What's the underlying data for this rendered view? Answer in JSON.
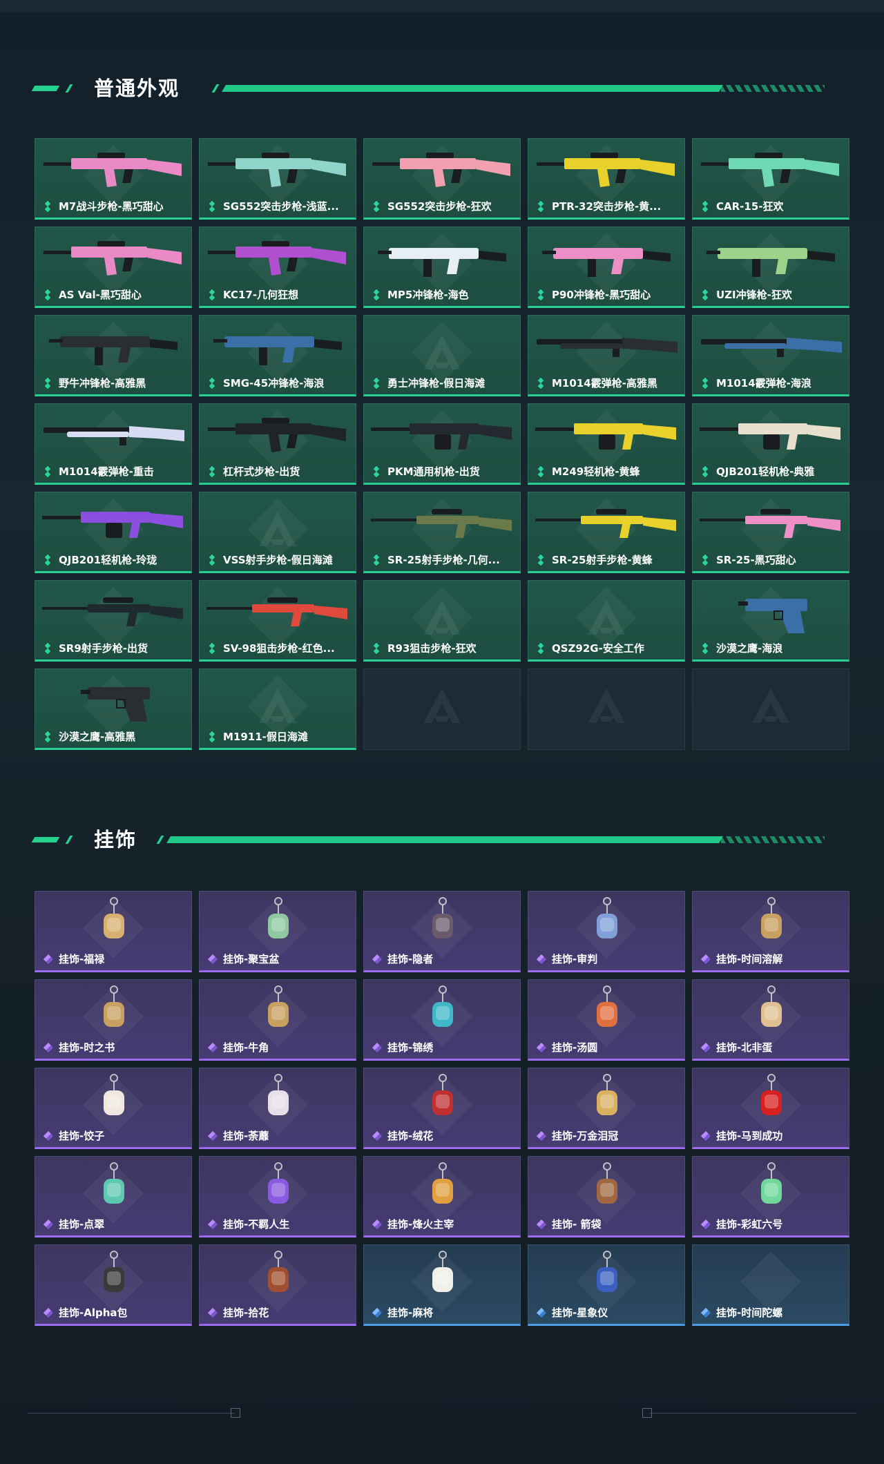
{
  "sections": {
    "skins_title": "普通外观",
    "charms_title": "挂饰"
  },
  "skins": [
    {
      "label": "M7战斗步枪-黑巧甜心",
      "color": "#e98ac6",
      "icon": "rifle-icon"
    },
    {
      "label": "SG552突击步枪-浅蓝...",
      "color": "#8fd4c9",
      "icon": "rifle-icon"
    },
    {
      "label": "SG552突击步枪-狂欢",
      "color": "#f2a0b0",
      "icon": "rifle-icon"
    },
    {
      "label": "PTR-32突击步枪-黄...",
      "color": "#e7d12a",
      "icon": "rifle-icon"
    },
    {
      "label": "CAR-15-狂欢",
      "color": "#6fd8b4",
      "icon": "rifle-icon"
    },
    {
      "label": "AS Val-黑巧甜心",
      "color": "#e98ac6",
      "icon": "rifle-icon"
    },
    {
      "label": "KC17-几何狂想",
      "color": "#b04fd0",
      "icon": "rifle-icon"
    },
    {
      "label": "MP5冲锋枪-海色",
      "color": "#e8eef5",
      "icon": "smg-icon"
    },
    {
      "label": "P90冲锋枪-黑巧甜心",
      "color": "#ef8fc8",
      "icon": "smg-icon"
    },
    {
      "label": "UZI冲锋枪-狂欢",
      "color": "#9cd28a",
      "icon": "smg-icon"
    },
    {
      "label": "野牛冲锋枪-高雅黑",
      "color": "#2a2d31",
      "icon": "smg-icon"
    },
    {
      "label": "SMG-45冲锋枪-海浪",
      "color": "#3a6fa8",
      "icon": "smg-icon"
    },
    {
      "label": "勇士冲锋枪-假日海滩",
      "color": "",
      "icon": "placeholder-icon"
    },
    {
      "label": "M1014霰弹枪-高雅黑",
      "color": "#2a2d31",
      "icon": "shotgun-icon"
    },
    {
      "label": "M1014霰弹枪-海浪",
      "color": "#3a6fa8",
      "icon": "shotgun-icon"
    },
    {
      "label": "M1014霰弹枪-重击",
      "color": "#d8dcf2",
      "icon": "shotgun-icon"
    },
    {
      "label": "杠杆式步枪-出货",
      "color": "#1e2428",
      "icon": "rifle-icon"
    },
    {
      "label": "PKM通用机枪-出货",
      "color": "#23292e",
      "icon": "lmg-icon"
    },
    {
      "label": "M249轻机枪-黄蜂",
      "color": "#e7d12a",
      "icon": "lmg-icon"
    },
    {
      "label": "QJB201轻机枪-典雅",
      "color": "#e8e0cc",
      "icon": "lmg-icon"
    },
    {
      "label": "QJB201轻机枪-玲珑",
      "color": "#8c4fe0",
      "icon": "lmg-icon"
    },
    {
      "label": "VSS射手步枪-假日海滩",
      "color": "",
      "icon": "placeholder-icon"
    },
    {
      "label": "SR-25射手步枪-几何...",
      "color": "#6b7a4a",
      "icon": "sniper-icon"
    },
    {
      "label": "SR-25射手步枪-黄蜂",
      "color": "#e7d12a",
      "icon": "sniper-icon"
    },
    {
      "label": "SR-25-黑巧甜心",
      "color": "#ef8fc8",
      "icon": "sniper-icon"
    },
    {
      "label": "SR9射手步枪-出货",
      "color": "#1e2a30",
      "icon": "sniper-icon"
    },
    {
      "label": "SV-98狙击步枪-红色...",
      "color": "#e04a3c",
      "icon": "sniper-icon"
    },
    {
      "label": "R93狙击步枪-狂欢",
      "color": "",
      "icon": "placeholder-icon"
    },
    {
      "label": "QSZ92G-安全工作",
      "color": "",
      "icon": "placeholder-icon"
    },
    {
      "label": "沙漠之鹰-海浪",
      "color": "#3a6fa8",
      "icon": "pistol-icon"
    },
    {
      "label": "沙漠之鹰-高雅黑",
      "color": "#2a2d31",
      "icon": "pistol-icon"
    },
    {
      "label": "M1911-假日海滩",
      "color": "",
      "icon": "placeholder-icon"
    }
  ],
  "charms": [
    {
      "label": "挂饰-福禄",
      "rarity": "purple",
      "color": "#d8b070"
    },
    {
      "label": "挂饰-聚宝盆",
      "rarity": "purple",
      "color": "#8fc8a0"
    },
    {
      "label": "挂饰-隐者",
      "rarity": "purple",
      "color": "#6a5a6a"
    },
    {
      "label": "挂饰-审判",
      "rarity": "purple",
      "color": "#7fa0d8"
    },
    {
      "label": "挂饰-时间溶解",
      "rarity": "purple",
      "color": "#c8a060"
    },
    {
      "label": "挂饰-时之书",
      "rarity": "purple",
      "color": "#c8a060"
    },
    {
      "label": "挂饰-牛角",
      "rarity": "purple",
      "color": "#c8a060"
    },
    {
      "label": "挂饰-锦绣",
      "rarity": "purple",
      "color": "#3fb8c8"
    },
    {
      "label": "挂饰-汤圆",
      "rarity": "purple",
      "color": "#e07040"
    },
    {
      "label": "挂饰-北非蛋",
      "rarity": "purple",
      "color": "#e0c090"
    },
    {
      "label": "挂饰-饺子",
      "rarity": "purple",
      "color": "#f0e8e0"
    },
    {
      "label": "挂饰-荼蘼",
      "rarity": "purple",
      "color": "#e8e0e8"
    },
    {
      "label": "挂饰-绒花",
      "rarity": "purple",
      "color": "#c03030"
    },
    {
      "label": "挂饰-万金泪冠",
      "rarity": "purple",
      "color": "#d8b060"
    },
    {
      "label": "挂饰-马到成功",
      "rarity": "purple",
      "color": "#d82020"
    },
    {
      "label": "挂饰-点翠",
      "rarity": "purple",
      "color": "#5fc8b0"
    },
    {
      "label": "挂饰-不羁人生",
      "rarity": "purple",
      "color": "#8a5ae0"
    },
    {
      "label": "挂饰-烽火主宰",
      "rarity": "purple",
      "color": "#e0a040"
    },
    {
      "label": "挂饰- 箭袋",
      "rarity": "purple",
      "color": "#a06840"
    },
    {
      "label": "挂饰-彩虹六号",
      "rarity": "purple",
      "color": "#6fd89a"
    },
    {
      "label": "挂饰-Alpha包",
      "rarity": "purple",
      "color": "#3a3a3a"
    },
    {
      "label": "挂饰-拾花",
      "rarity": "purple",
      "color": "#a05030"
    },
    {
      "label": "挂饰-麻将",
      "rarity": "blue",
      "color": "#f0f0e8"
    },
    {
      "label": "挂饰-星象仪",
      "rarity": "blue",
      "color": "#3a5fc0"
    },
    {
      "label": "挂饰-时间陀螺",
      "rarity": "blue",
      "color": ""
    }
  ],
  "empty_slots": 3,
  "colors": {
    "accent_green": "#25d08e",
    "accent_purple": "#9c6cf0",
    "accent_blue": "#4f9be8"
  }
}
